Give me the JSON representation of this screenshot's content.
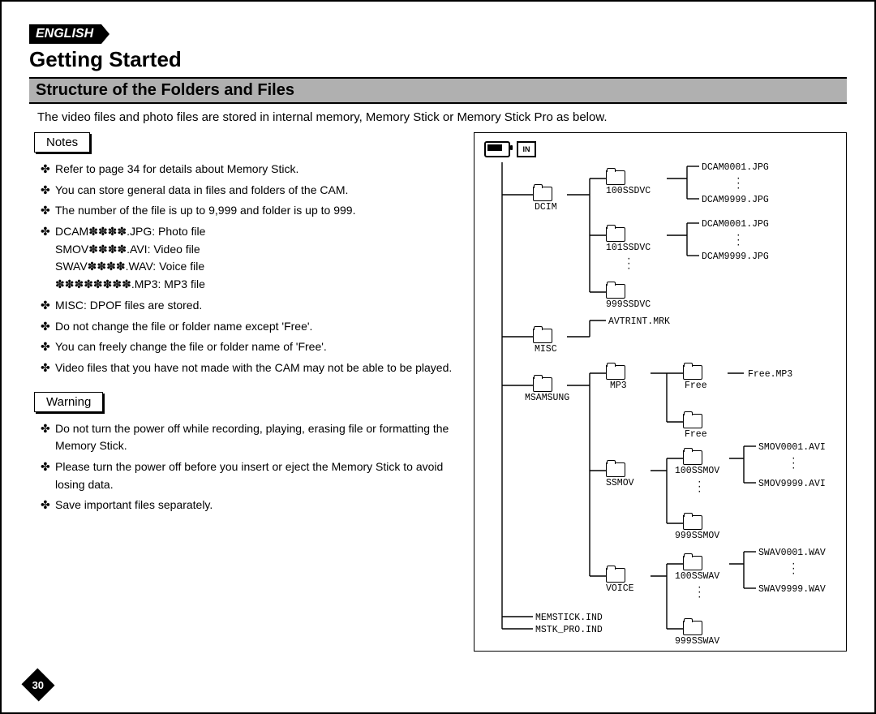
{
  "lang_badge": "ENGLISH",
  "h1": "Getting Started",
  "subheader": "Structure of the Folders and Files",
  "intro": "The video files and photo files are stored in internal memory, Memory Stick or Memory Stick Pro as below.",
  "notes_header": "Notes",
  "notes": [
    "Refer to page 34 for details about Memory Stick.",
    "You can store general data in files and folders of the CAM.",
    "The number of the file is up to 9,999 and folder is up to 999.",
    "DCAM✽✽✽✽.JPG: Photo file",
    "MISC: DPOF files are stored.",
    "Do not change the file or folder name except 'Free'.",
    "You can freely change the file or folder name of 'Free'.",
    "Video files that you have not made with the CAM may not be able to be played."
  ],
  "notes_sub": {
    "3_a": "SMOV✽✽✽✽.AVI: Video file",
    "3_b": "SWAV✽✽✽✽.WAV: Voice file",
    "3_c": "✽✽✽✽✽✽✽✽.MP3: MP3 file"
  },
  "warning_header": "Warning",
  "warnings": [
    "Do not turn the power off while recording, playing, erasing file or formatting the Memory Stick.",
    "Please turn the power off before you insert or eject the Memory Stick to avoid losing data.",
    "Save important files separately."
  ],
  "page_number": "30",
  "panel": {
    "in_label": "IN",
    "labels": {
      "dcim": "DCIM",
      "ssdvc100": "100SSDVC",
      "ssdvc101": "101SSDVC",
      "ssdvc999": "999SSDVC",
      "dcam1": "DCAM0001.JPG",
      "dcam9999": "DCAM9999.JPG",
      "dcam1b": "DCAM0001.JPG",
      "dcam9999b": "DCAM9999.JPG",
      "misc": "MISC",
      "avtrint": "AVTRINT.MRK",
      "msamsung": "MSAMSUNG",
      "mp3": "MP3",
      "free": "Free",
      "free2": "Free",
      "freemp3": "Free.MP3",
      "ssmov": "SSMOV",
      "ssmov100": "100SSMOV",
      "ssmov999": "999SSMOV",
      "smov1": "SMOV0001.AVI",
      "smov9999": "SMOV9999.AVI",
      "voice": "VOICE",
      "sswav100": "100SSWAV",
      "sswav999": "999SSWAV",
      "swav1": "SWAV0001.WAV",
      "swav9999": "SWAV9999.WAV",
      "memstick": "MEMSTICK.IND",
      "mstkpro": "MSTK_PRO.IND"
    }
  }
}
